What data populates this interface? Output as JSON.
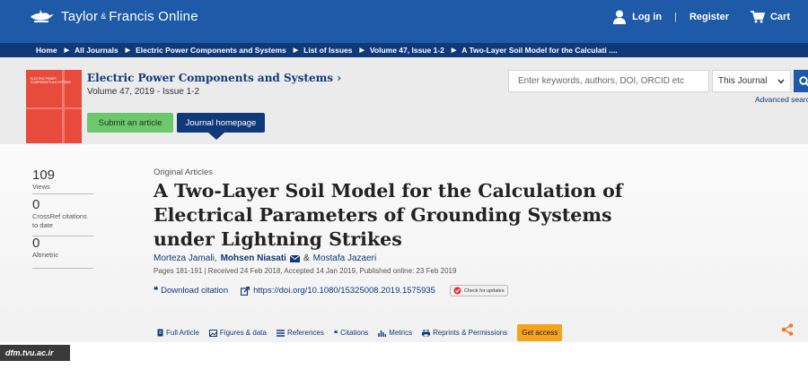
{
  "header": {
    "logo_text": "Taylor",
    "logo_amp": "&",
    "logo_text2": "Francis Online",
    "login": "Log in",
    "register": "Register",
    "cart": "Cart",
    "sep": "|"
  },
  "breadcrumb": [
    "Home",
    "All Journals",
    "Electric Power Components and Systems",
    "List of Issues",
    "Volume 47, Issue 1-2",
    "A Two-Layer Soil Model for the Calculati ...."
  ],
  "journal": {
    "title": "Electric Power Components and Systems",
    "chevron": "›",
    "volume": "Volume 47, 2019 - Issue 1-2",
    "submit": "Submit an article",
    "homepage": "Journal homepage",
    "cover_text": "ELECTRIC POWER COMPONENTS and SYSTEMS"
  },
  "search": {
    "placeholder": "Enter keywords, authors, DOI, ORCID etc",
    "scope": "This Journal",
    "advanced": "Advanced search"
  },
  "metrics": [
    {
      "value": "109",
      "label": "Views"
    },
    {
      "value": "0",
      "label": "CrossRef citations to date"
    },
    {
      "value": "0",
      "label": "Altmetric"
    }
  ],
  "article": {
    "type": "Original Articles",
    "title": "A Two-Layer Soil Model for the Calculation of Electrical Parameters of Grounding Systems under Lightning Strikes",
    "author1": "Morteza Jamali",
    "comma1": ",",
    "author2": "Mohsen Niasati",
    "amp": "&",
    "author3": "Mostafa Jazaeri",
    "meta": "Pages 181-191 | Received 24 Feb 2018, Accepted 14 Jan 2019, Published online: 23 Feb 2019",
    "download": "Download citation",
    "doi": "https://doi.org/10.1080/15325008.2019.1575935",
    "updates": "Check for updates"
  },
  "tabs": [
    "Full Article",
    "Figures & data",
    "References",
    "Citations",
    "Metrics",
    "Reprints & Permissions"
  ],
  "get_access": "Get access",
  "watermark": "dfm.tvu.ac.ir",
  "colors": {
    "primary": "#1e5aa8",
    "dark": "#10397a",
    "green": "#6ec76c",
    "orange": "#f5a21c",
    "cover": "#e84b3c"
  }
}
